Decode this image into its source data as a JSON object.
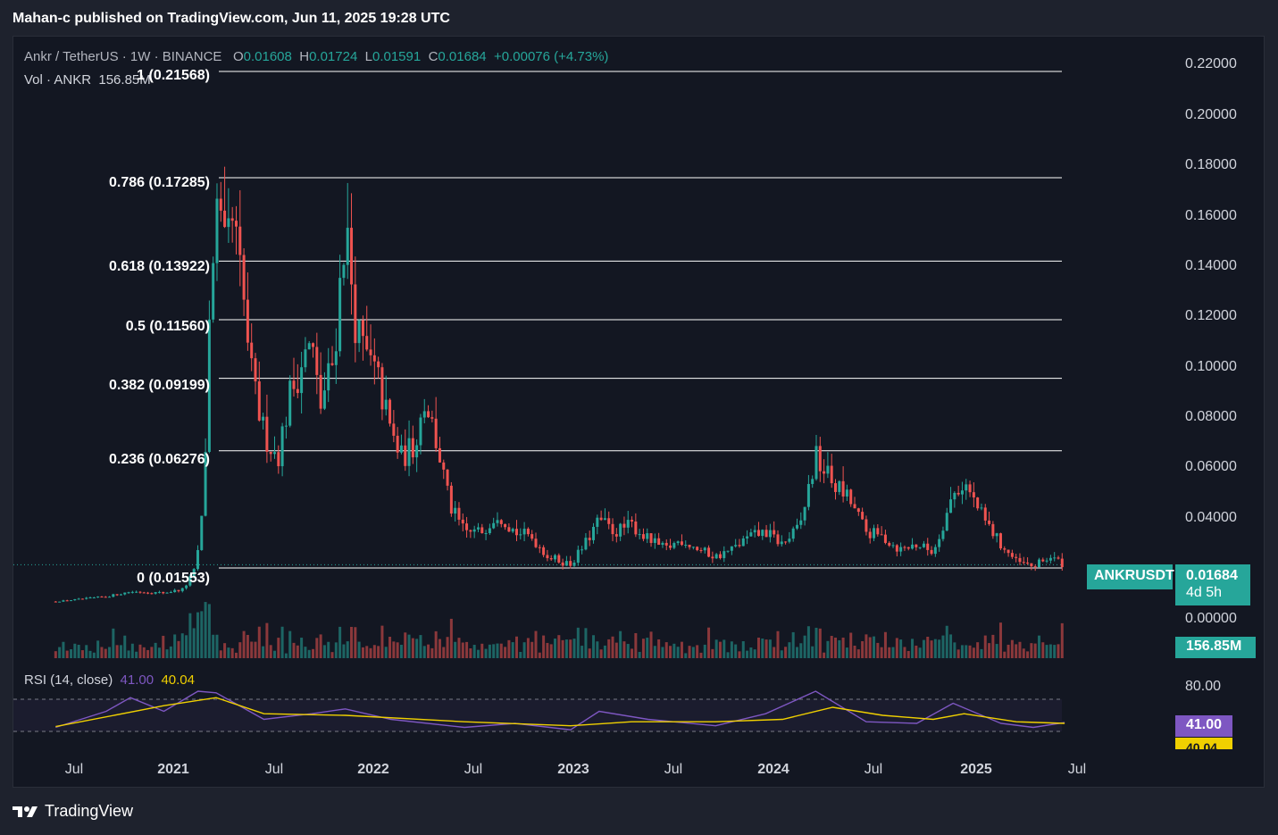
{
  "caption": "Mahan-c published on TradingView.com, Jun 11, 2025 19:28 UTC",
  "legend": {
    "symbol": "Ankr / TetherUS · 1W · BINANCE",
    "o_label": "O",
    "o": "0.01608",
    "h_label": "H",
    "h": "0.01724",
    "l_label": "L",
    "l": "0.01591",
    "c_label": "C",
    "c": "0.01684",
    "change": "+0.00076 (+4.73%)",
    "vol_label": "Vol · ANKR",
    "vol_value": "156.85M"
  },
  "rsi_legend": {
    "label": "RSI (14, close)",
    "rsi": "41.00",
    "ma": "40.04"
  },
  "tags": {
    "symbol": "ANKRUSDT",
    "price": "0.01684",
    "countdown": "4d 5h",
    "volume": "156.85M",
    "rsi": "41.00",
    "rsi_ma": "40.04"
  },
  "footer": {
    "brand": "TradingView"
  },
  "colors": {
    "up": "#26a69a",
    "down": "#ef5350",
    "rsi": "#7e57c2",
    "rsi_ma": "#f0d000",
    "background": "#131722"
  },
  "chart_data": {
    "type": "candlestick",
    "title": "Ankr / TetherUS · 1W · BINANCE",
    "y_ticks": [
      "0.22000",
      "0.20000",
      "0.18000",
      "0.16000",
      "0.14000",
      "0.12000",
      "0.10000",
      "0.08000",
      "0.06000",
      "0.04000",
      "0.00000"
    ],
    "x_ticks": [
      "Jul",
      "2021",
      "Jul",
      "2022",
      "Jul",
      "2023",
      "Jul",
      "2024",
      "Jul",
      "2025",
      "Jul"
    ],
    "fib_levels": [
      {
        "label": "1 (0.21568)",
        "value": 0.21568
      },
      {
        "label": "0.786 (0.17285)",
        "value": 0.17285
      },
      {
        "label": "0.618 (0.13922)",
        "value": 0.13922
      },
      {
        "label": "0.5 (0.11560)",
        "value": 0.1156
      },
      {
        "label": "0.382 (0.09199)",
        "value": 0.09199
      },
      {
        "label": "0.236 (0.06276)",
        "value": 0.06276
      },
      {
        "label": "0 (0.01553)",
        "value": 0.01553
      }
    ],
    "price_path": [
      [
        "2020-06-01",
        0.002
      ],
      [
        "2020-09-01",
        0.004
      ],
      [
        "2020-10-15",
        0.006
      ],
      [
        "2020-12-15",
        0.0055
      ],
      [
        "2021-01-20",
        0.007
      ],
      [
        "2021-02-10",
        0.015
      ],
      [
        "2021-02-25",
        0.04
      ],
      [
        "2021-03-10",
        0.13
      ],
      [
        "2021-03-20",
        0.16
      ],
      [
        "2021-04-05",
        0.14
      ],
      [
        "2021-04-20",
        0.155
      ],
      [
        "2021-05-10",
        0.12
      ],
      [
        "2021-05-25",
        0.09
      ],
      [
        "2021-06-15",
        0.07
      ],
      [
        "2021-07-10",
        0.06
      ],
      [
        "2021-08-01",
        0.085
      ],
      [
        "2021-08-25",
        0.1
      ],
      [
        "2021-09-10",
        0.105
      ],
      [
        "2021-09-25",
        0.08
      ],
      [
        "2021-10-20",
        0.1
      ],
      [
        "2021-11-10",
        0.155
      ],
      [
        "2021-12-01",
        0.11
      ],
      [
        "2021-12-20",
        0.1
      ],
      [
        "2022-01-10",
        0.09
      ],
      [
        "2022-02-01",
        0.07
      ],
      [
        "2022-02-20",
        0.06
      ],
      [
        "2022-03-15",
        0.065
      ],
      [
        "2022-04-05",
        0.085
      ],
      [
        "2022-05-01",
        0.06
      ],
      [
        "2022-05-20",
        0.04
      ],
      [
        "2022-06-15",
        0.03
      ],
      [
        "2022-07-15",
        0.03
      ],
      [
        "2022-08-15",
        0.038
      ],
      [
        "2022-09-15",
        0.03
      ],
      [
        "2022-10-15",
        0.028
      ],
      [
        "2022-11-15",
        0.02
      ],
      [
        "2022-12-25",
        0.017
      ],
      [
        "2023-01-20",
        0.025
      ],
      [
        "2023-02-15",
        0.035
      ],
      [
        "2023-03-15",
        0.03
      ],
      [
        "2023-04-15",
        0.033
      ],
      [
        "2023-05-15",
        0.027
      ],
      [
        "2023-06-15",
        0.023
      ],
      [
        "2023-07-15",
        0.027
      ],
      [
        "2023-08-15",
        0.023
      ],
      [
        "2023-09-15",
        0.02
      ],
      [
        "2023-10-15",
        0.023
      ],
      [
        "2023-11-15",
        0.028
      ],
      [
        "2023-12-15",
        0.03
      ],
      [
        "2024-01-15",
        0.025
      ],
      [
        "2024-02-15",
        0.032
      ],
      [
        "2024-03-15",
        0.06
      ],
      [
        "2024-04-15",
        0.05
      ],
      [
        "2024-05-15",
        0.043
      ],
      [
        "2024-06-15",
        0.03
      ],
      [
        "2024-07-15",
        0.028
      ],
      [
        "2024-08-15",
        0.023
      ],
      [
        "2024-09-15",
        0.025
      ],
      [
        "2024-10-15",
        0.022
      ],
      [
        "2024-11-20",
        0.045
      ],
      [
        "2024-12-10",
        0.05
      ],
      [
        "2025-01-15",
        0.035
      ],
      [
        "2025-02-15",
        0.025
      ],
      [
        "2025-03-15",
        0.018
      ],
      [
        "2025-04-15",
        0.016
      ],
      [
        "2025-05-15",
        0.02
      ],
      [
        "2025-06-11",
        0.01684
      ]
    ],
    "rsi": {
      "levels": [
        70,
        30
      ],
      "series": [
        [
          "2020-06-01",
          35
        ],
        [
          "2020-09-01",
          55
        ],
        [
          "2020-10-15",
          72
        ],
        [
          "2020-12-15",
          55
        ],
        [
          "2021-02-15",
          80
        ],
        [
          "2021-03-20",
          78
        ],
        [
          "2021-06-15",
          45
        ],
        [
          "2021-09-10",
          52
        ],
        [
          "2021-11-10",
          58
        ],
        [
          "2022-02-01",
          45
        ],
        [
          "2022-06-15",
          35
        ],
        [
          "2022-09-15",
          40
        ],
        [
          "2022-12-25",
          32
        ],
        [
          "2023-02-15",
          55
        ],
        [
          "2023-05-15",
          45
        ],
        [
          "2023-09-15",
          37
        ],
        [
          "2023-12-15",
          52
        ],
        [
          "2024-03-15",
          80
        ],
        [
          "2024-06-15",
          42
        ],
        [
          "2024-09-15",
          40
        ],
        [
          "2024-11-20",
          65
        ],
        [
          "2025-02-15",
          40
        ],
        [
          "2025-04-15",
          35
        ],
        [
          "2025-06-11",
          41
        ]
      ],
      "ma": [
        [
          "2020-06-01",
          36
        ],
        [
          "2020-12-15",
          62
        ],
        [
          "2021-03-20",
          72
        ],
        [
          "2021-06-15",
          52
        ],
        [
          "2021-11-10",
          50
        ],
        [
          "2022-06-15",
          42
        ],
        [
          "2022-12-25",
          37
        ],
        [
          "2023-04-15",
          42
        ],
        [
          "2023-09-15",
          42
        ],
        [
          "2024-01-15",
          45
        ],
        [
          "2024-04-15",
          60
        ],
        [
          "2024-07-15",
          50
        ],
        [
          "2024-10-15",
          45
        ],
        [
          "2024-12-10",
          52
        ],
        [
          "2025-03-15",
          42
        ],
        [
          "2025-06-11",
          40.04
        ]
      ]
    }
  }
}
